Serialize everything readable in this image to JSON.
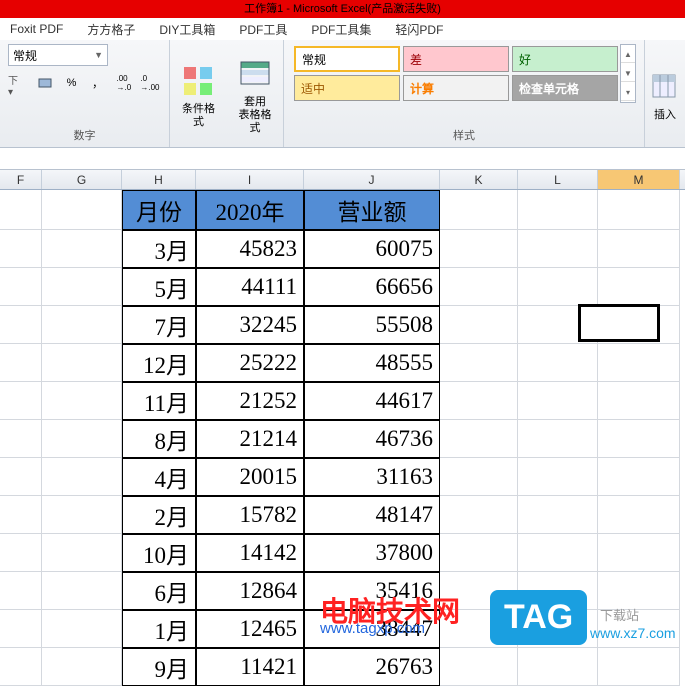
{
  "title": "工作簿1 - Microsoft Excel(产品激活失败)",
  "tabs": [
    "Foxit PDF",
    "方方格子",
    "DIY工具箱",
    "PDF工具",
    "PDF工具集",
    "轻闪PDF"
  ],
  "ribbon": {
    "number_format": "常规",
    "number_label": "数字",
    "fmt_currency": "％",
    "fmt_comma": "，",
    "fmt_inc": ".00→.0",
    "fmt_dec": ".0→.00",
    "cond_format": "条件格式",
    "table_format": "套用\n表格格式",
    "styles_label": "样式",
    "style_normal": "常规",
    "style_bad": "差",
    "style_good": "好",
    "style_neutral": "适中",
    "style_calc": "计算",
    "style_check": "检查单元格",
    "insert": "插入"
  },
  "columns": [
    "F",
    "G",
    "H",
    "I",
    "J",
    "K",
    "L",
    "M"
  ],
  "selected_col": "M",
  "headers": {
    "month": "月份",
    "year": "2020年",
    "revenue": "营业额"
  },
  "rows": [
    {
      "m": "3月",
      "y": "45823",
      "r": "60075"
    },
    {
      "m": "5月",
      "y": "44111",
      "r": "66656"
    },
    {
      "m": "7月",
      "y": "32245",
      "r": "55508"
    },
    {
      "m": "12月",
      "y": "25222",
      "r": "48555"
    },
    {
      "m": "11月",
      "y": "21252",
      "r": "44617"
    },
    {
      "m": "8月",
      "y": "21214",
      "r": "46736"
    },
    {
      "m": "4月",
      "y": "20015",
      "r": "31163"
    },
    {
      "m": "2月",
      "y": "15782",
      "r": "48147"
    },
    {
      "m": "10月",
      "y": "14142",
      "r": "37800"
    },
    {
      "m": "6月",
      "y": "12864",
      "r": "35416"
    },
    {
      "m": "1月",
      "y": "12465",
      "r": "38447"
    },
    {
      "m": "9月",
      "y": "11421",
      "r": "26763"
    }
  ],
  "watermark": {
    "site_cn": "电脑技术网",
    "site_url": "www.tagxp.com",
    "tag": "TAG",
    "dl_site": "下载站",
    "dl_url": "www.xz7.com"
  }
}
